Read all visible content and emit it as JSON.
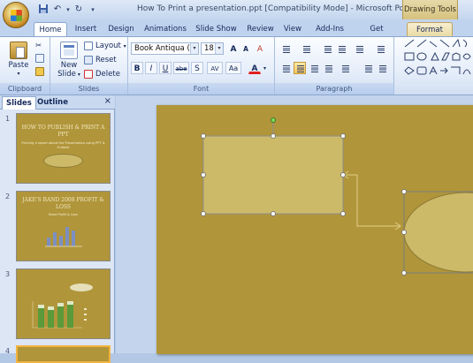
{
  "window": {
    "title": "How To Print a presentation.ppt [Compatibility Mode] - Microsoft PowerPoint",
    "contextual_tab_group": "Drawing Tools"
  },
  "tabs": [
    "Home",
    "Insert",
    "Design",
    "Animations",
    "Slide Show",
    "Review",
    "View",
    "Add-Ins",
    "Get Started",
    "Format"
  ],
  "active_tab": "Home",
  "ribbon": {
    "clipboard": {
      "paste_label": "Paste",
      "group_label": "Clipboard"
    },
    "slides": {
      "new_slide_label": "New",
      "new_slide_label2": "Slide",
      "layout_label": "Layout",
      "reset_label": "Reset",
      "delete_label": "Delete",
      "group_label": "Slides"
    },
    "font": {
      "font_name": "Book Antiqua (Bod",
      "font_size": "18",
      "bold": "B",
      "italic": "I",
      "underline": "U",
      "strike": "abe",
      "shadow": "S",
      "spacing": "AV",
      "change_case": "Aa",
      "grow": "A",
      "shrink": "A",
      "clear": "A",
      "color_letter": "A",
      "group_label": "Font"
    },
    "paragraph": {
      "group_label": "Paragraph"
    }
  },
  "panel": {
    "tabs": [
      "Slides",
      "Outline"
    ],
    "active": "Slides",
    "close": "×"
  },
  "thumbnails": [
    {
      "num": "1",
      "title": "HOW TO PUBLISH & PRINT A PPT",
      "subtitle": "Printing a report about the Presentation using PPT & Outlook"
    },
    {
      "num": "2",
      "title": "JAKE'S BAND 2008 PROFIT & LOSS",
      "subtitle": "Band Profit & Loss"
    },
    {
      "num": "3",
      "title": "",
      "subtitle": ""
    },
    {
      "num": "4",
      "title": "",
      "subtitle": ""
    }
  ],
  "slide_colors": {
    "background": "#b0953a",
    "rectangle": "#cdba68",
    "connector": "#e3cf86"
  },
  "icons": [
    "office-logo",
    "save-icon",
    "undo-icon",
    "redo-icon",
    "qat-customize-icon",
    "paste-icon",
    "cut-icon",
    "copy-icon",
    "format-painter-icon",
    "new-slide-icon",
    "layout-icon",
    "reset-icon",
    "delete-icon",
    "bullets-icon",
    "numbering-icon",
    "align-left-icon",
    "center-icon",
    "align-right-icon",
    "justify-icon",
    "shape-icons"
  ]
}
